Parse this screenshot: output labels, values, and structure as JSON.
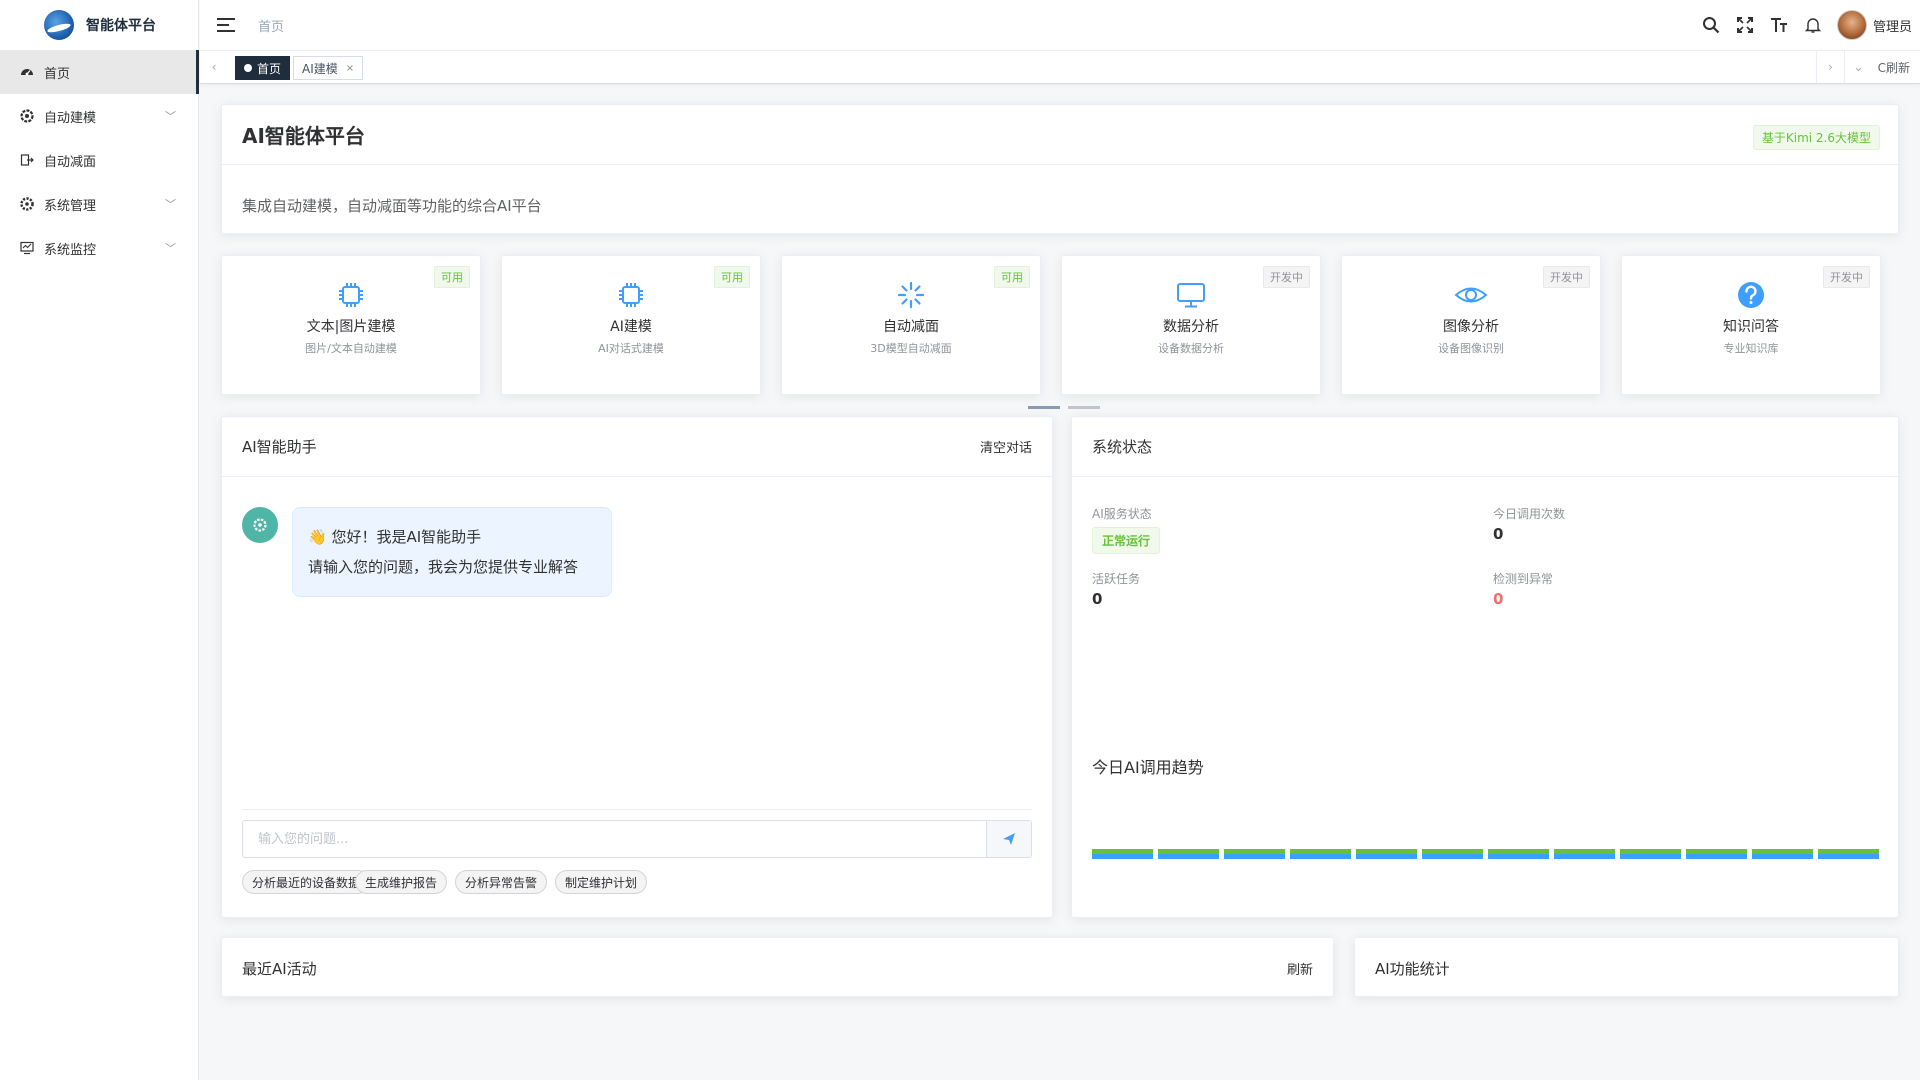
{
  "app": {
    "title": "智能体平台"
  },
  "sidebar": {
    "items": [
      {
        "label": "首页",
        "icon": "dashboard-icon",
        "active": true
      },
      {
        "label": "自动建模",
        "icon": "gear-icon",
        "expandable": true
      },
      {
        "label": "自动减面",
        "icon": "export-icon"
      },
      {
        "label": "系统管理",
        "icon": "system-icon",
        "expandable": true
      },
      {
        "label": "系统监控",
        "icon": "monitor-icon",
        "expandable": true
      }
    ]
  },
  "header": {
    "breadcrumb": "首页",
    "user": "管理员",
    "icons": [
      "search-icon",
      "fullscreen-icon",
      "font-size-icon",
      "bell-icon"
    ]
  },
  "tags": {
    "items": [
      {
        "label": "首页",
        "active": true
      },
      {
        "label": "AI建模",
        "closable": true
      }
    ],
    "refresh": "C刷新"
  },
  "hero": {
    "title": "AI智能体平台",
    "badge": "基于Kimi 2.6大模型",
    "desc": "集成自动建模，自动减面等功能的综合AI平台"
  },
  "features": [
    {
      "name": "文本|图片建模",
      "desc": "图片/文本自动建模",
      "status": "可用",
      "icon": "chip-icon"
    },
    {
      "name": "AI建模",
      "desc": "AI对话式建模",
      "status": "可用",
      "icon": "chip-icon"
    },
    {
      "name": "自动减面",
      "desc": "3D模型自动减面",
      "status": "可用",
      "icon": "loading-icon"
    },
    {
      "name": "数据分析",
      "desc": "设备数据分析",
      "status": "开发中",
      "icon": "monitor-icon"
    },
    {
      "name": "图像分析",
      "desc": "设备图像识别",
      "status": "开发中",
      "icon": "eye-icon"
    },
    {
      "name": "知识问答",
      "desc": "专业知识库",
      "status": "开发中",
      "icon": "question-icon"
    }
  ],
  "assistant": {
    "title": "AI智能助手",
    "clear": "清空对话",
    "greeting_line1": "👋 您好！我是AI智能助手",
    "greeting_line2": "请输入您的问题，我会为您提供专业解答",
    "placeholder": "输入您的问题...",
    "quick_actions": [
      "分析最近的设备数据",
      "生成维护报告",
      "分析异常告警",
      "制定维护计划"
    ]
  },
  "system_status": {
    "title": "系统状态",
    "service_label": "AI服务状态",
    "service_value": "正常运行",
    "calls_label": "今日调用次数",
    "calls_value": "0",
    "tasks_label": "活跃任务",
    "tasks_value": "0",
    "anomaly_label": "检测到异常",
    "anomaly_value": "0",
    "trend_title": "今日AI调用趋势",
    "bar_count": 12
  },
  "activity": {
    "title": "最近AI活动",
    "refresh": "刷新"
  },
  "stats": {
    "title": "AI功能统计"
  },
  "colors": {
    "accent": "#409eff",
    "success": "#67c23a",
    "danger": "#f56c6c",
    "dark": "#1f2d3d"
  }
}
